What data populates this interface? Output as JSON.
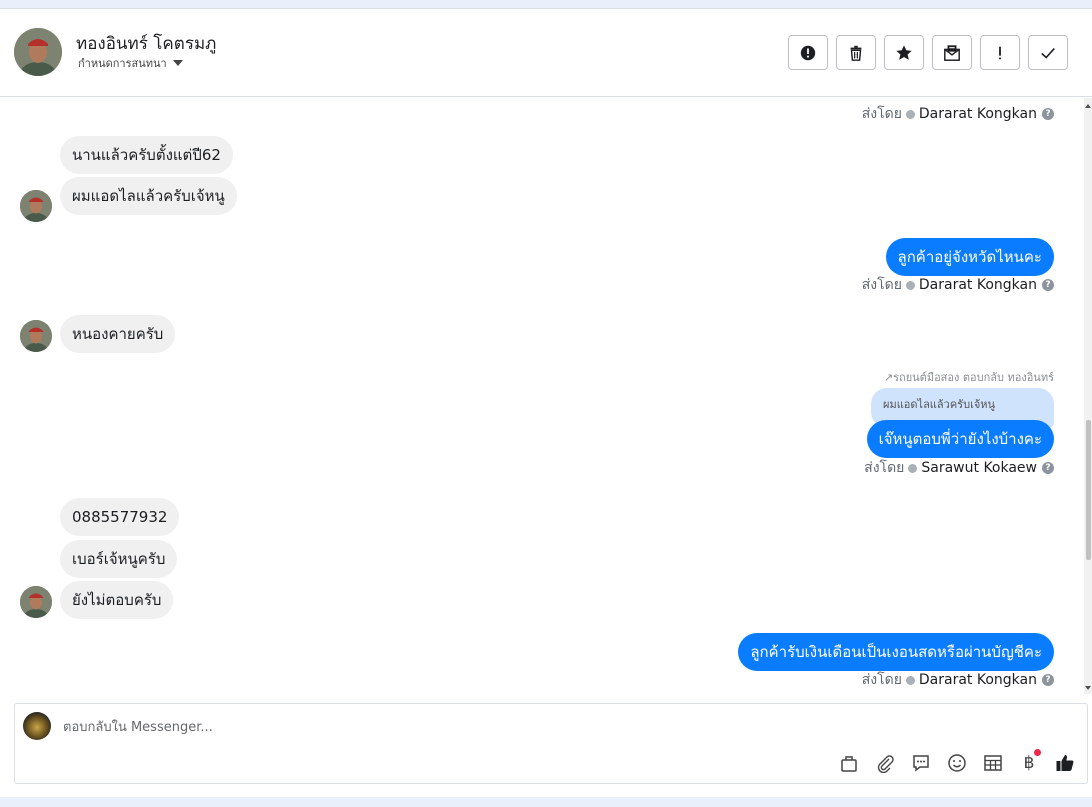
{
  "header": {
    "name": "ทองอินทร์ โคตรมภู",
    "subtitle": "กำหนดการสนทนา",
    "actions": [
      {
        "icon": "alert-circle-icon"
      },
      {
        "icon": "trash-icon"
      },
      {
        "icon": "star-icon"
      },
      {
        "icon": "mark-unread-icon"
      },
      {
        "icon": "exclamation-icon"
      },
      {
        "icon": "check-icon"
      }
    ]
  },
  "labels": {
    "sent_by": "ส่งโดย"
  },
  "messages": {
    "m0_sender": "Dararat Kongkan",
    "m1_text": "นานแล้วครับตั้งแต่ปี62",
    "m2_text": "ผมแอดไลแล้วครับเจ้หนู",
    "m3_text": "ลูกค้าอยู่จังหวัดไหนคะ",
    "m3_sender": "Dararat Kongkan",
    "m4_text": "หนองคายครับ",
    "m5_reply_meta": "รถยนต์มือสอง ตอบกลับ ทองอินทร์",
    "m5_quote": "ผมแอดไลแล้วครับเจ้หนู",
    "m5_text": "เจ๊หนูตอบพี่ว่ายังไงบ้างคะ",
    "m5_sender": "Sarawut Kokaew",
    "m6_text": "0885577932",
    "m7_text": "เบอร์เจ้หนูครับ",
    "m8_text": "ยังไม่ตอบครับ",
    "m9_text": "ลูกค้ารับเงินเดือนเป็นเงอนสดหรือผ่านบัญชีคะ",
    "m9_sender": "Dararat Kongkan"
  },
  "composer": {
    "placeholder": "ตอบกลับใน Messenger...",
    "tools": [
      "bag-icon",
      "paperclip-icon",
      "chat-bubble-icon",
      "emoji-icon",
      "table-icon",
      "baht-icon",
      "thumbs-up-icon"
    ],
    "baht_symbol": "฿"
  },
  "colors": {
    "outgoing": "#0a7cff",
    "incoming": "#f0f0f0",
    "reply_quote": "#cfe3fd"
  }
}
